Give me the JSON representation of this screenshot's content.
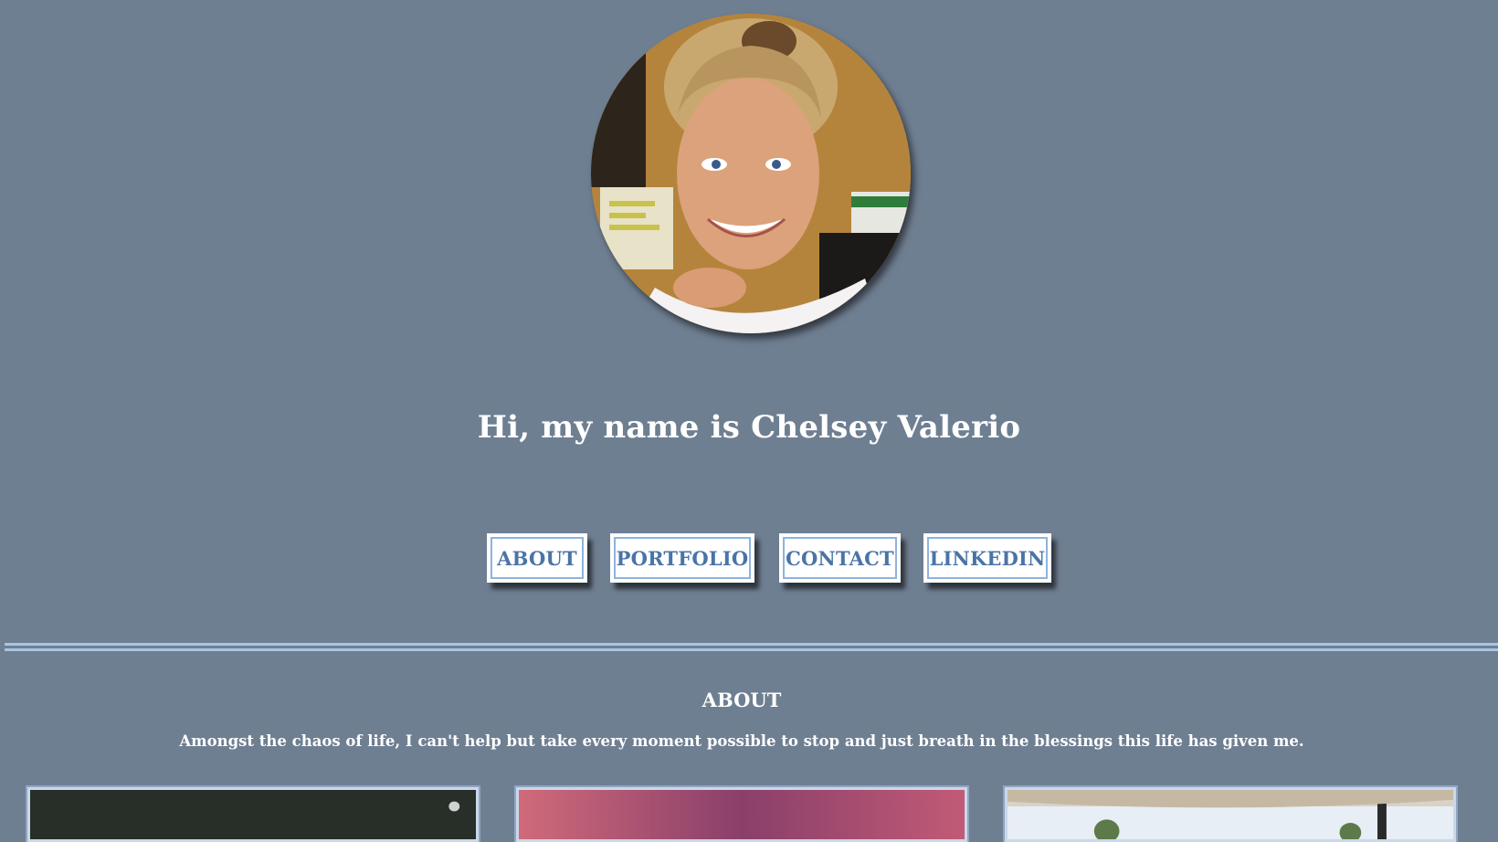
{
  "profile": {
    "avatar_alt": "Profile photo"
  },
  "hero": {
    "title": "Hi, my name is Chelsey Valerio"
  },
  "nav": {
    "items": [
      {
        "label": "ABOUT"
      },
      {
        "label": "PORTFOLIO"
      },
      {
        "label": "CONTACT"
      },
      {
        "label": "LINKEDIN"
      }
    ]
  },
  "about": {
    "heading": "ABOUT",
    "text": "Amongst the chaos of life, I can't help but take every moment possible to stop and just breath in the blessings this life has given me."
  },
  "colors": {
    "background": "#6f7f92",
    "button_text": "#4a74a6",
    "button_border": "#8fb3dd",
    "divider": "#a9c4e3"
  }
}
